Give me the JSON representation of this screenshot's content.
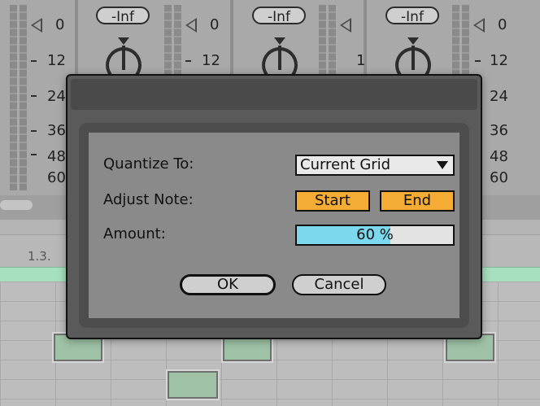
{
  "mixer": {
    "channels": [
      {
        "volume_display": "-Inf"
      },
      {
        "volume_display": "-Inf"
      },
      {
        "volume_display": "-Inf"
      }
    ],
    "meter_scale": [
      "0",
      "12",
      "24",
      "36",
      "48",
      "60"
    ],
    "meter_scale_partial": [
      "0",
      "12",
      "1"
    ]
  },
  "arrangement": {
    "ruler_label": "1.3."
  },
  "dialog": {
    "quantize_to": {
      "label": "Quantize To:",
      "value": "Current Grid"
    },
    "adjust_note": {
      "label": "Adjust Note:",
      "start_label": "Start",
      "end_label": "End"
    },
    "amount": {
      "label": "Amount:",
      "value_text": "60 %",
      "fraction": 0.6
    },
    "ok_label": "OK",
    "cancel_label": "Cancel"
  },
  "colors": {
    "toggle_active": "#f5ac35",
    "amount_fill": "#7cd8ec",
    "note_green": "#9fc2a6"
  }
}
